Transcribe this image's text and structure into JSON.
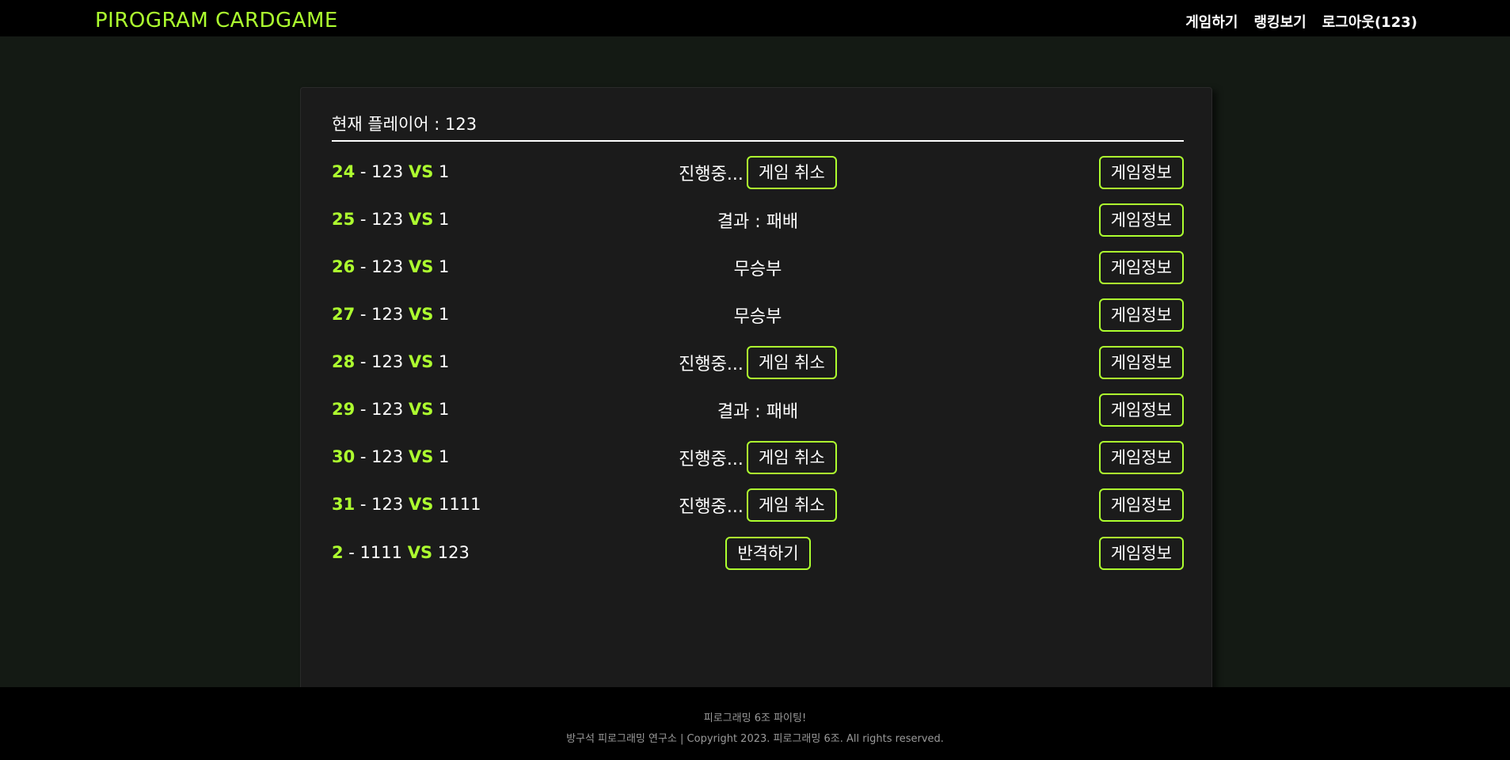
{
  "header": {
    "brand": "PIROGRAM CARDGAME",
    "nav": [
      "게임하기",
      "랭킹보기",
      "로그아웃(123)"
    ]
  },
  "panel": {
    "player_label": "현재 플레이어 : 123"
  },
  "games": [
    {
      "id": "24",
      "sep": " - ",
      "p1": "123",
      "vs": "VS",
      "p2": "1",
      "status": "진행중...",
      "action": "게임 취소",
      "info": "게임정보"
    },
    {
      "id": "25",
      "sep": " - ",
      "p1": "123",
      "vs": "VS",
      "p2": "1",
      "status": "결과 : 패배",
      "action": "",
      "info": "게임정보"
    },
    {
      "id": "26",
      "sep": " - ",
      "p1": "123",
      "vs": "VS",
      "p2": "1",
      "status": "무승부",
      "action": "",
      "info": "게임정보"
    },
    {
      "id": "27",
      "sep": " - ",
      "p1": "123",
      "vs": "VS",
      "p2": "1",
      "status": "무승부",
      "action": "",
      "info": "게임정보"
    },
    {
      "id": "28",
      "sep": " - ",
      "p1": "123",
      "vs": "VS",
      "p2": "1",
      "status": "진행중...",
      "action": "게임 취소",
      "info": "게임정보"
    },
    {
      "id": "29",
      "sep": " - ",
      "p1": "123",
      "vs": "VS",
      "p2": "1",
      "status": "결과 : 패배",
      "action": "",
      "info": "게임정보"
    },
    {
      "id": "30",
      "sep": " - ",
      "p1": "123",
      "vs": "VS",
      "p2": "1",
      "status": "진행중...",
      "action": "게임 취소",
      "info": "게임정보"
    },
    {
      "id": "31",
      "sep": " - ",
      "p1": "123",
      "vs": "VS",
      "p2": "1111",
      "status": "진행중...",
      "action": "게임 취소",
      "info": "게임정보"
    },
    {
      "id": "2",
      "sep": " - ",
      "p1": "1111",
      "vs": "VS",
      "p2": "123",
      "status": "",
      "action": "반격하기",
      "info": "게임정보"
    }
  ],
  "footer": {
    "line1": "피로그래밍 6조 파이팅!",
    "line2": "방구석 피로그래밍 연구소 | Copyright 2023. 피로그래밍 6조. All rights reserved."
  },
  "colors": {
    "accent": "#adff2f",
    "background": "#141a14",
    "panel": "#1b1b1b",
    "bar": "#000000"
  }
}
